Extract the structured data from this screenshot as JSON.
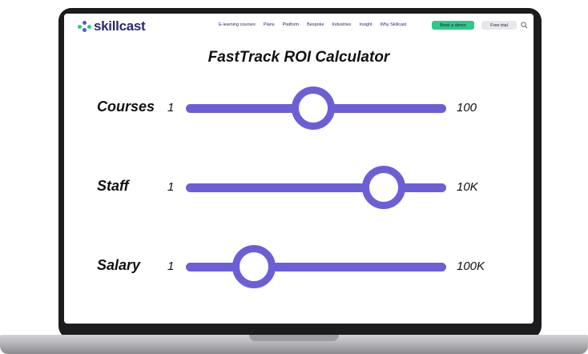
{
  "brand": {
    "name": "skillcast"
  },
  "nav": {
    "links": [
      "E-learning courses",
      "Plans",
      "Platform",
      "Bespoke",
      "Industries",
      "Insight",
      "Why Skillcast"
    ],
    "demo_label": "Book a demo",
    "trial_label": "Free trial"
  },
  "calculator": {
    "title": "FastTrack ROI Calculator",
    "sliders": [
      {
        "label": "Courses",
        "min_label": "1",
        "max_label": "100",
        "level": 0.49
      },
      {
        "label": "Staff",
        "min_label": "1",
        "max_label": "10K",
        "level": 0.76
      },
      {
        "label": "Salary",
        "min_label": "1",
        "max_label": "100K",
        "level": 0.26
      }
    ]
  },
  "colors": {
    "accent": "#6c5fd6",
    "brand_green": "#2ec88a",
    "brand_navy": "#2a2a6e"
  },
  "icons": {
    "search": "search-icon"
  }
}
